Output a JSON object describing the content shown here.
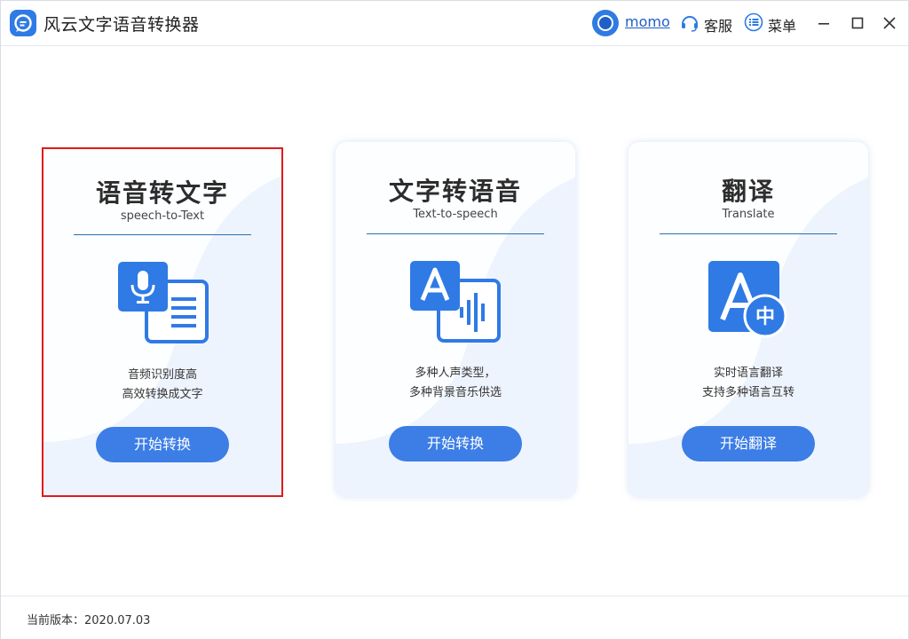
{
  "app": {
    "title": "风云文字语音转换器"
  },
  "header": {
    "user_name": "momo",
    "service_label": "客服",
    "menu_label": "菜单"
  },
  "cards": [
    {
      "title": "语音转文字",
      "subtitle": "speech-to-Text",
      "desc_line1": "音频识别度高",
      "desc_line2": "高效转换成文字",
      "button": "开始转换",
      "icon": "speech-to-text-icon",
      "selected": true
    },
    {
      "title": "文字转语音",
      "subtitle": "Text-to-speech",
      "desc_line1": "多种人声类型，",
      "desc_line2": "多种背景音乐供选",
      "button": "开始转换",
      "icon": "text-to-speech-icon",
      "selected": false
    },
    {
      "title": "翻译",
      "subtitle": "Translate",
      "desc_line1": "实时语言翻译",
      "desc_line2": "支持多种语言互转",
      "button": "开始翻译",
      "icon": "translate-icon",
      "icon_text_a": "A",
      "icon_text_zh": "中",
      "selected": false
    }
  ],
  "footer": {
    "version_text": "当前版本：2020.07.03"
  },
  "colors": {
    "accent": "#3c7de6",
    "selection_border": "#e01a1a",
    "rule": "#2b6fb0"
  }
}
